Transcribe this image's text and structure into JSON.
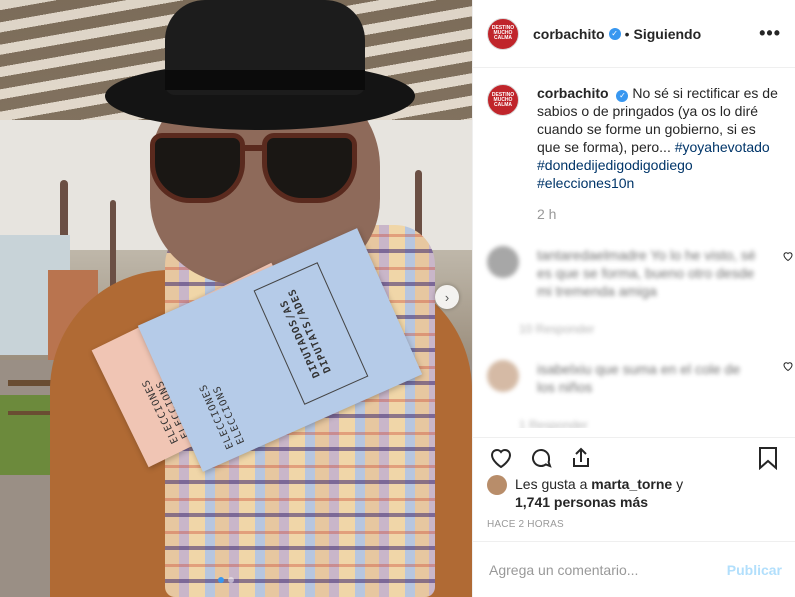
{
  "post": {
    "username": "corbachito",
    "follow_status": "Siguiendo",
    "more_icon": "•••",
    "separator": "•",
    "verified_icon": "✓",
    "avatar_text": "DESTINO MUCHO CALMA"
  },
  "photo": {
    "envelope_pink_text": "ELECCIONES\nELECCIONS",
    "envelope_blue_text": "ELECCIONES\nELECCIONS",
    "envelope_blue_box": "DIPUTADOS/AS\nDIPUTATS/ADES",
    "next_icon": "›"
  },
  "caption": {
    "username": "corbachito",
    "text": "No sé si rectificar es de sabios o de pringados (ya os lo diré cuando se forme un gobierno, si es que se forma), pero... ",
    "tag1": "#yoyahevotado",
    "tag2": "#dondedijedigodigodiego",
    "tag3": "#elecciones10n",
    "time": "2 h"
  },
  "blurred_comments": [
    {
      "text": "tantaredaelmadre Yo lo he visto, sé es que se forma, bueno otro desde mi tremenda amiga",
      "meta": "10 Responder"
    },
    {
      "text": "isabelxiu que suma en el cole de los niños",
      "meta": "1 Responder"
    }
  ],
  "actions": {
    "like_icon": "heart-icon",
    "comment_icon": "comment-icon",
    "share_icon": "share-icon",
    "save_icon": "bookmark-icon"
  },
  "likes": {
    "prefix": "Les gusta a ",
    "user": "marta_torne",
    "mid": " y",
    "count": "1,741 personas más"
  },
  "timestamp": "HACE 2 HORAS",
  "comment_box": {
    "placeholder": "Agrega un comentario...",
    "publish": "Publicar"
  },
  "colors": {
    "accent": "#3897f0",
    "tag": "#003569",
    "publish_disabled": "#b2dffc"
  }
}
